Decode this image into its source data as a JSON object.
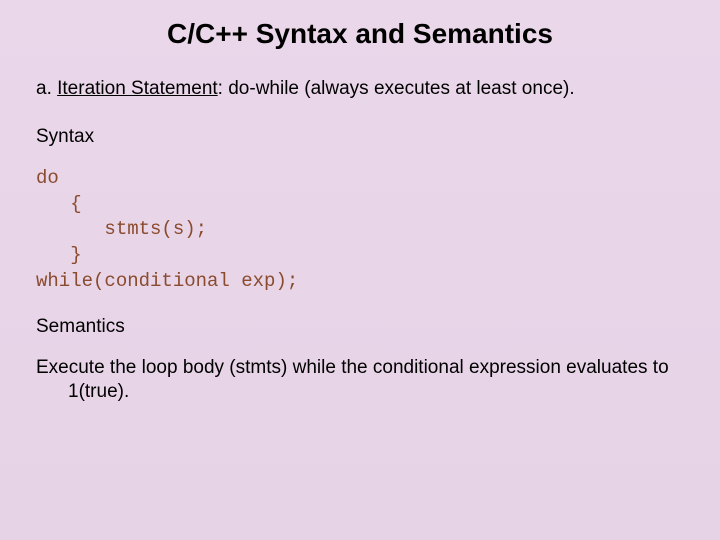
{
  "title": "C/C++ Syntax and Semantics",
  "section": {
    "prefix": "a. ",
    "underlined": "Iteration Statement",
    "suffix": ": do-while (always executes at least once)."
  },
  "syntax_label": "Syntax",
  "code": "do\n   {\n      stmts(s);\n   }\nwhile(conditional exp);",
  "semantics_label": "Semantics",
  "semantics_body": "Execute the loop body (stmts) while the conditional expression evaluates to 1(true)."
}
